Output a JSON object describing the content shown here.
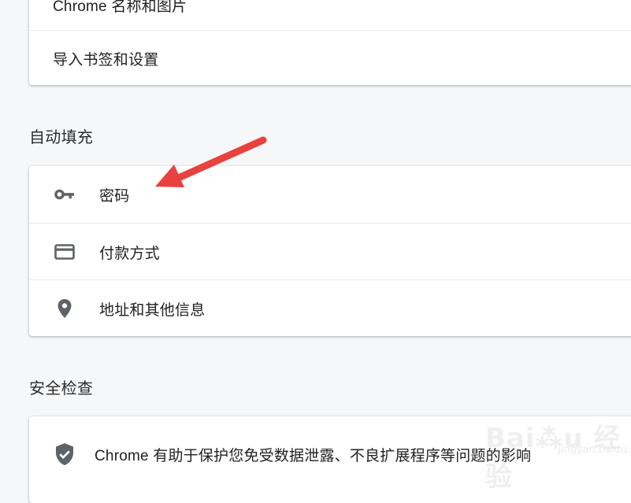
{
  "top_card": {
    "items": [
      {
        "label": "Chrome 名称和图片"
      },
      {
        "label": "导入书签和设置"
      }
    ]
  },
  "autofill": {
    "title": "自动填充",
    "items": [
      {
        "label": "密码",
        "icon": "key-icon"
      },
      {
        "label": "付款方式",
        "icon": "credit-card-icon"
      },
      {
        "label": "地址和其他信息",
        "icon": "location-pin-icon"
      }
    ]
  },
  "safety_check": {
    "title": "安全检查",
    "description": "Chrome 有助于保护您免受数据泄露、不良扩展程序等问题的影响",
    "icon": "shield-check-icon"
  },
  "annotation": {
    "arrow_color": "#e8423f"
  },
  "colors": {
    "background": "#f6f7f9",
    "card": "#ffffff",
    "icon": "#5f6368",
    "text": "#202124"
  }
}
